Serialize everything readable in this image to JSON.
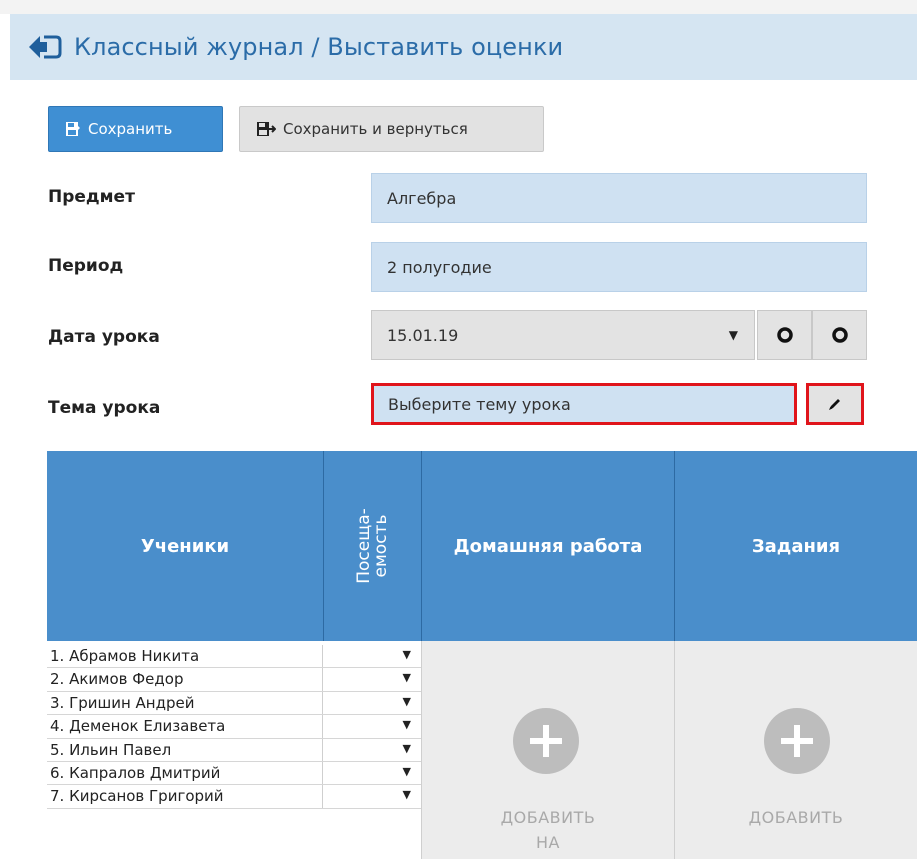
{
  "header": {
    "title": "Классный журнал / Выставить оценки"
  },
  "toolbar": {
    "save_label": "Сохранить",
    "save_back_label": "Сохранить и вернуться"
  },
  "form": {
    "subject_label": "Предмет",
    "subject_value": "Алгебра",
    "period_label": "Период",
    "period_value": "2 полугодие",
    "date_label": "Дата урока",
    "date_value": "15.01.19",
    "topic_label": "Тема урока",
    "topic_value": "Выберите тему урока"
  },
  "table": {
    "col_students": "Ученики",
    "col_attendance": "Посеща-\nемость",
    "col_homework": "Домашняя работа",
    "col_tasks": "Задания",
    "students": [
      "1. Абрамов Никита",
      "2. Акимов Федор",
      "3. Гришин Андрей",
      "4. Деменок Елизавета",
      "5. Ильин Павел",
      "6. Капралов Дмитрий",
      "7. Кирсанов Григорий"
    ],
    "homework_add_label": "ДОБАВИТЬ\nНА",
    "tasks_add_label": "ДОБАВИТЬ"
  },
  "colors": {
    "header_bg": "#d5e5f2",
    "title": "#2b6ca8",
    "primary_button": "#3f8fd3",
    "table_header": "#4a8ecb",
    "highlight": "#e0141b"
  }
}
